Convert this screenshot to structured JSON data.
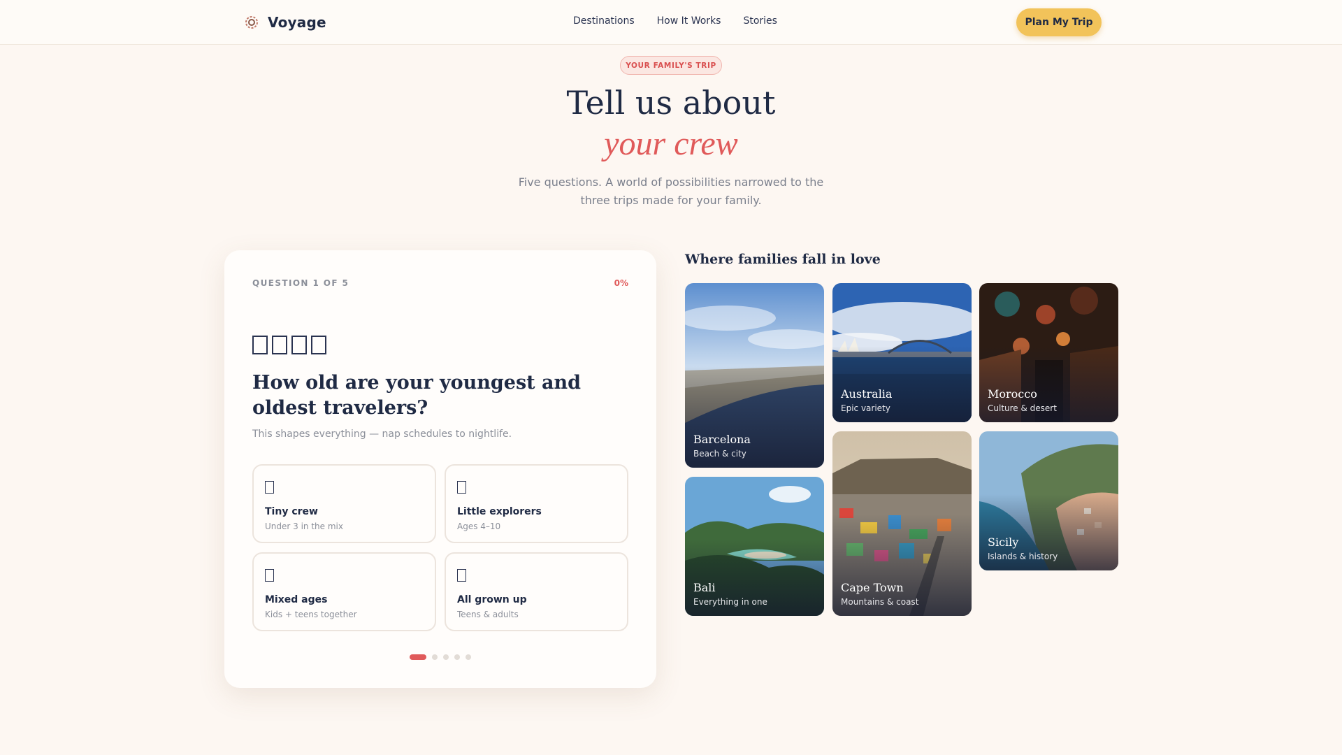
{
  "nav": {
    "brand": "Voyage",
    "links": [
      "Destinations",
      "How It Works",
      "Stories"
    ],
    "cta": "Plan My Trip"
  },
  "hero": {
    "badge": "YOUR FAMILY'S TRIP",
    "title_line1": "Tell us about",
    "title_line2": "your crew",
    "subtitle_line1": "Five questions. A world of possibilities narrowed to the",
    "subtitle_line2": "three trips made for your family."
  },
  "quiz": {
    "step": "QUESTION 1 OF 5",
    "progress_label": "0%",
    "progress_percent": 0,
    "question": "How old are your youngest and oldest travelers?",
    "help": "This shapes everything — nap schedules to nightlife.",
    "options": [
      {
        "title": "Tiny crew",
        "sub": "Under 3 in the mix"
      },
      {
        "title": "Little explorers",
        "sub": "Ages 4–10"
      },
      {
        "title": "Mixed ages",
        "sub": "Kids + teens together"
      },
      {
        "title": "All grown up",
        "sub": "Teens & adults"
      }
    ],
    "total_steps": 5,
    "current_step": 1
  },
  "gallery": {
    "title": "Where families fall in love",
    "tiles": [
      {
        "name": "Barcelona",
        "sub": "Beach & city"
      },
      {
        "name": "Australia",
        "sub": "Epic variety"
      },
      {
        "name": "Morocco",
        "sub": "Culture & desert"
      },
      {
        "name": "Bali",
        "sub": "Everything in one"
      },
      {
        "name": "Cape Town",
        "sub": "Mountains & coast"
      },
      {
        "name": "Sicily",
        "sub": "Islands & history"
      }
    ]
  },
  "colors": {
    "accent": "#e05a5a",
    "cta": "#f2c35a",
    "ink": "#1f2a44",
    "background": "#fdf7f2"
  }
}
